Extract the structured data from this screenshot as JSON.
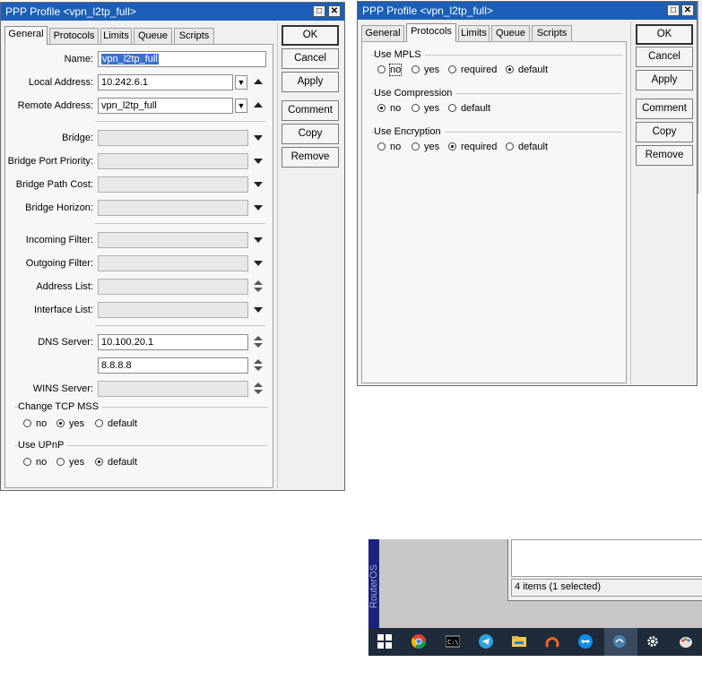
{
  "left_window": {
    "title": "PPP Profile <vpn_l2tp_full>",
    "tabs": [
      "General",
      "Protocols",
      "Limits",
      "Queue",
      "Scripts"
    ],
    "buttons": [
      "OK",
      "Cancel",
      "Apply",
      "Comment",
      "Copy",
      "Remove"
    ],
    "fields": {
      "name_label": "Name:",
      "name_value": "vpn_l2tp_full",
      "local_label": "Local Address:",
      "local_value": "10.242.6.1",
      "remote_label": "Remote Address:",
      "remote_value": "vpn_l2tp_full",
      "bridge_label": "Bridge:",
      "bridge_port_priority_label": "Bridge Port Priority:",
      "bridge_path_cost_label": "Bridge Path Cost:",
      "bridge_horizon_label": "Bridge Horizon:",
      "incoming_filter_label": "Incoming Filter:",
      "outgoing_filter_label": "Outgoing Filter:",
      "address_list_label": "Address List:",
      "interface_list_label": "Interface List:",
      "dns_label": "DNS Server:",
      "dns_value_1": "10.100.20.1",
      "dns_value_2": "8.8.8.8",
      "wins_label": "WINS Server:"
    },
    "change_tcp_mss": {
      "label": "Change TCP MSS",
      "options": [
        "no",
        "yes",
        "default"
      ],
      "selected": "yes"
    },
    "use_upnp": {
      "label": "Use UPnP",
      "options": [
        "no",
        "yes",
        "default"
      ],
      "selected": "default"
    }
  },
  "right_window": {
    "title": "PPP Profile <vpn_l2tp_full>",
    "tabs": [
      "General",
      "Protocols",
      "Limits",
      "Queue",
      "Scripts"
    ],
    "buttons": [
      "OK",
      "Cancel",
      "Apply",
      "Comment",
      "Copy",
      "Remove"
    ],
    "use_mpls": {
      "label": "Use MPLS",
      "options": [
        "no",
        "yes",
        "required",
        "default"
      ],
      "selected": "default"
    },
    "use_compression": {
      "label": "Use Compression",
      "options": [
        "no",
        "yes",
        "default"
      ],
      "selected": "no"
    },
    "use_encryption": {
      "label": "Use Encryption",
      "options": [
        "no",
        "yes",
        "required",
        "default"
      ],
      "selected": "required"
    }
  },
  "background_window": {
    "status_text": "4 items (1 selected)",
    "side_text": "RouterOS"
  },
  "taskbar": {
    "icons": [
      "windows-start-icon",
      "chrome-icon",
      "terminal-icon",
      "telegram-icon",
      "file-explorer-icon",
      "app-orange-icon",
      "teamviewer-icon",
      "winbox-icon",
      "settings-gear-icon",
      "paint-icon"
    ]
  },
  "colors": {
    "titlebar": "#1b5fb8",
    "selection": "#3b6fd0",
    "taskbar": "#1f2a3a"
  }
}
